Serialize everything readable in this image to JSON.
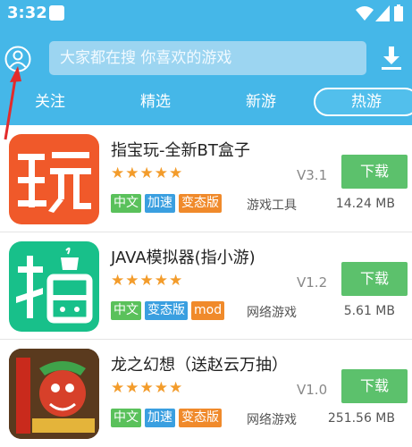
{
  "status": {
    "time": "3:32"
  },
  "search": {
    "placeholder": "大家都在搜  你喜欢的游戏"
  },
  "tabs": [
    "关注",
    "精选",
    "新游",
    "热游"
  ],
  "download_label": "下载",
  "apps": [
    {
      "title": "指宝玩-全新BT盒子",
      "rating": 5,
      "stars": "★★★★★",
      "version": "V3.1",
      "tags": [
        {
          "label": "中文",
          "color": "green"
        },
        {
          "label": "加速",
          "color": "blue"
        },
        {
          "label": "变态版",
          "color": "orange"
        }
      ],
      "category": "游戏工具",
      "size": "14.24 MB"
    },
    {
      "title": "JAVA模拟器(指小游)",
      "rating": 5,
      "stars": "★★★★★",
      "version": "V1.2",
      "tags": [
        {
          "label": "中文",
          "color": "green"
        },
        {
          "label": "变态版",
          "color": "blue"
        },
        {
          "label": "mod",
          "color": "orange"
        }
      ],
      "category": "网络游戏",
      "size": "5.61 MB"
    },
    {
      "title": "龙之幻想（送赵云万抽）",
      "rating": 5,
      "stars": "★★★★★",
      "version": "V1.0",
      "tags": [
        {
          "label": "中文",
          "color": "green"
        },
        {
          "label": "加速",
          "color": "blue"
        },
        {
          "label": "变态版",
          "color": "orange"
        }
      ],
      "category": "网络游戏",
      "size": "251.56 MB"
    }
  ],
  "colors": {
    "header": "#45b7e8",
    "download_button": "#5cc16c",
    "star": "#f39c2b"
  }
}
